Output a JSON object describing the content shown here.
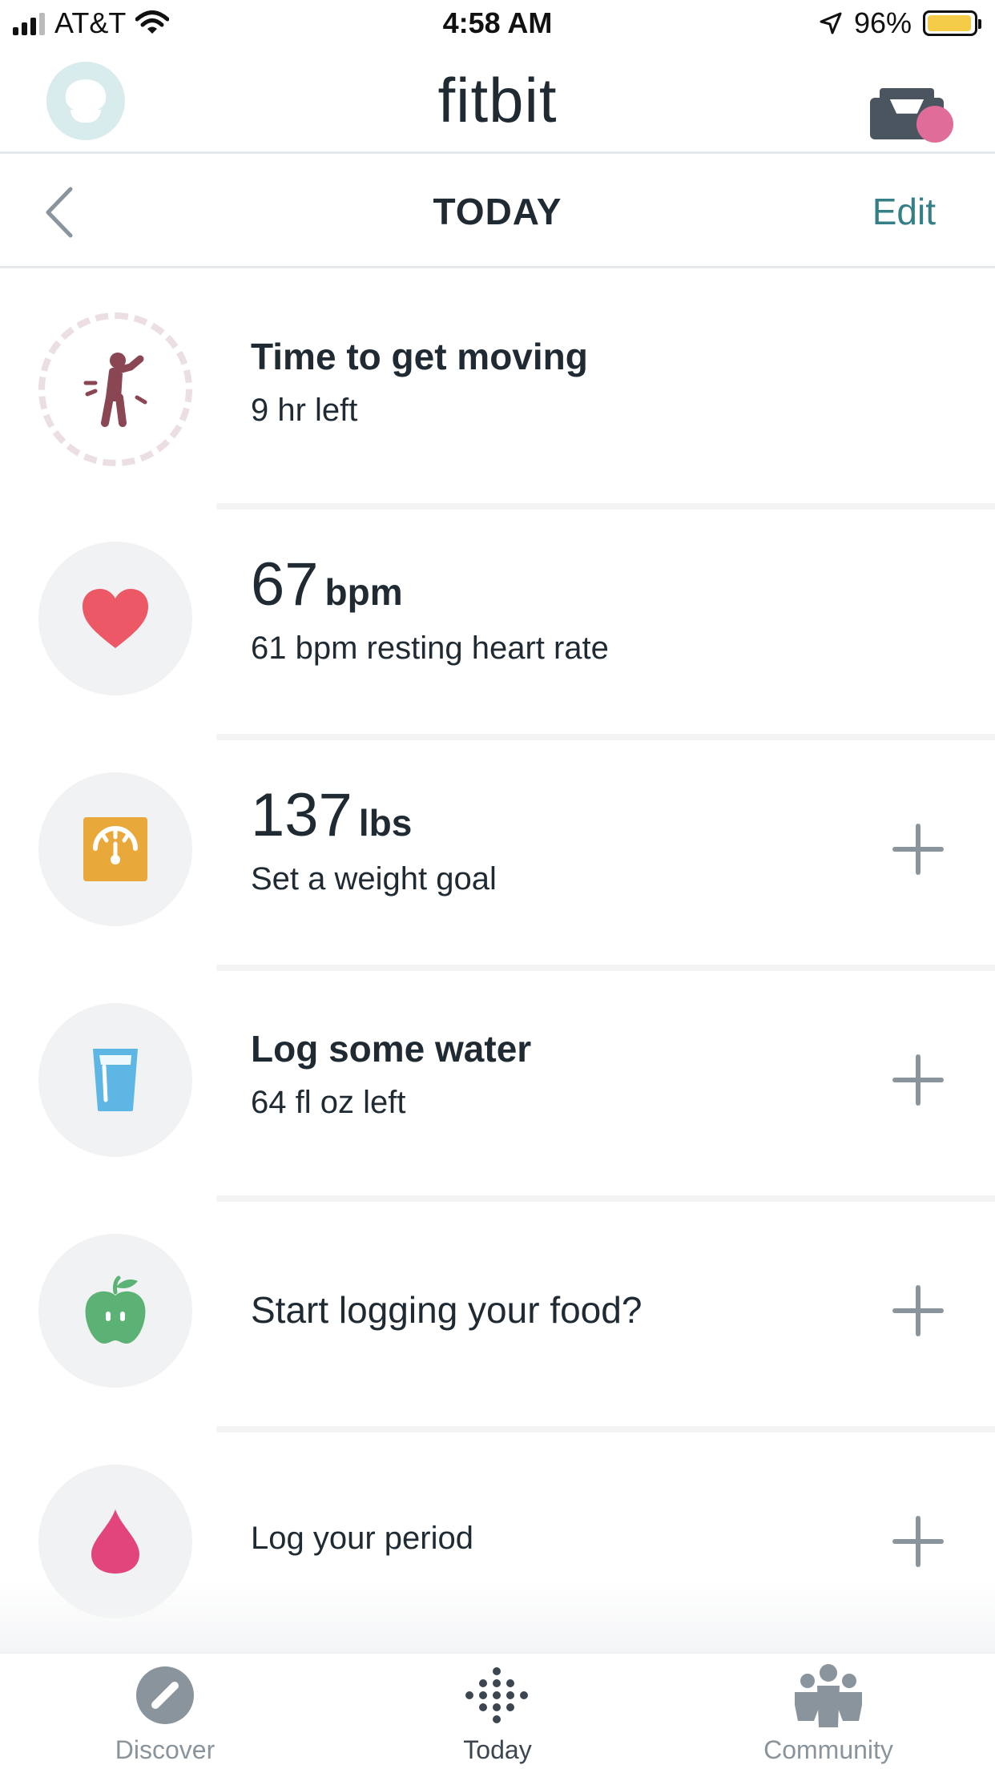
{
  "status_bar": {
    "carrier": "AT&T",
    "time": "4:58 AM",
    "battery": "96%",
    "battery_level": 0.96,
    "icons": [
      "signal-icon",
      "wifi-icon",
      "location-arrow-icon",
      "battery-icon"
    ],
    "battery_color": "#f4cc48"
  },
  "header": {
    "brand": "fitbit",
    "avatar_icon": "avatar-icon",
    "inbox_icon": "inbox-icon",
    "notification_color": "#e06c9a"
  },
  "subheader": {
    "title": "TODAY",
    "edit_label": "Edit",
    "back_icon": "chevron-left-icon",
    "accent_color": "#357f86"
  },
  "rows": [
    {
      "icon": "activity-person-icon",
      "title": "Time to get moving",
      "subtitle": "9 hr left"
    },
    {
      "icon": "heart-icon",
      "value": "67",
      "unit": "bpm",
      "subtitle": "61 bpm resting heart rate"
    },
    {
      "icon": "scale-icon",
      "value": "137",
      "unit": "lbs",
      "subtitle": "Set a weight goal",
      "action_icon": "plus-icon"
    },
    {
      "icon": "water-glass-icon",
      "title": "Log some water",
      "subtitle": "64 fl oz left",
      "action_icon": "plus-icon"
    },
    {
      "icon": "apple-icon",
      "title": "Start logging your food?",
      "action_icon": "plus-icon"
    },
    {
      "icon": "drop-icon",
      "title": "Log your period",
      "action_icon": "plus-icon"
    }
  ],
  "tabs": [
    {
      "label": "Discover",
      "icon": "compass-icon",
      "active": false
    },
    {
      "label": "Today",
      "icon": "fitbit-dots-icon",
      "active": true
    },
    {
      "label": "Community",
      "icon": "community-icon",
      "active": false
    }
  ]
}
